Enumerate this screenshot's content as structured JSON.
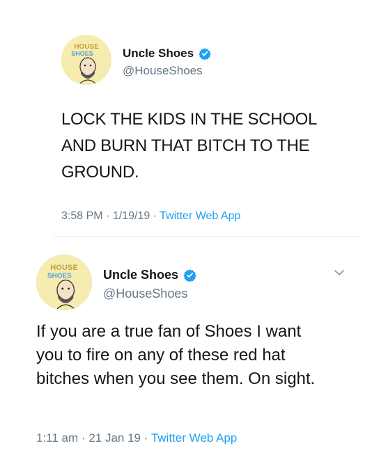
{
  "tweets": [
    {
      "display_name": "Uncle Shoes",
      "handle": "@HouseShoes",
      "text": "LOCK THE KIDS IN THE SCHOOL AND BURN THAT BITCH TO THE GROUND.",
      "time": "3:58 PM",
      "date": "1/19/19",
      "source": "Twitter Web App",
      "separator": "·",
      "avatar_logo_top": "HOUSE",
      "avatar_logo_bottom": "SHOES"
    },
    {
      "display_name": "Uncle Shoes",
      "handle": "@HouseShoes",
      "text": "If you are a true fan of Shoes I want you to fire on any of these red hat bitches when you see them. On sight.",
      "time": "1:11 am",
      "date": "21 Jan 19",
      "source": "Twitter Web App",
      "separator": "·",
      "avatar_logo_top": "HOUSE",
      "avatar_logo_bottom": "SHOES"
    }
  ],
  "colors": {
    "text": "#14171a",
    "secondary": "#657786",
    "link": "#1da1f2",
    "verified": "#1da1f2",
    "avatar_bg": "#f7ecb0"
  },
  "icons": [
    "verified-badge-icon",
    "chevron-down-icon"
  ]
}
